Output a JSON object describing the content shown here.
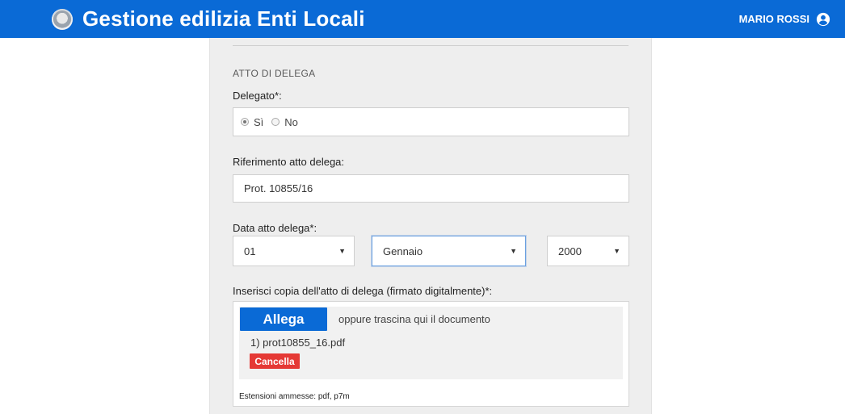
{
  "header": {
    "title": "Gestione edilizia Enti Locali",
    "user_name": "MARIO ROSSI",
    "user_icon": "user-circle-icon",
    "emblem_icon": "republic-emblem-icon"
  },
  "colors": {
    "brand_blue": "#0a6ad6",
    "danger_red": "#e53935",
    "panel_bg": "#eeeeee"
  },
  "form": {
    "section_title": "ATTO DI DELEGA",
    "delegato": {
      "label": "Delegato*:",
      "options": [
        "Sì",
        "No"
      ],
      "selected": "Sì"
    },
    "riferimento": {
      "label": "Riferimento atto delega:",
      "value": "Prot. 10855/16"
    },
    "data_atto": {
      "label": "Data atto delega*:",
      "day": "01",
      "month": "Gennaio",
      "year": "2000"
    },
    "upload": {
      "label": "Inserisci copia dell'atto di delega (firmato digitalmente)*:",
      "attach_label": "Allega",
      "drop_hint": "oppure trascina qui il documento",
      "files": [
        "1) prot10855_16.pdf"
      ],
      "delete_label": "Cancella",
      "extensions": "Estensioni ammesse: pdf, p7m"
    }
  }
}
